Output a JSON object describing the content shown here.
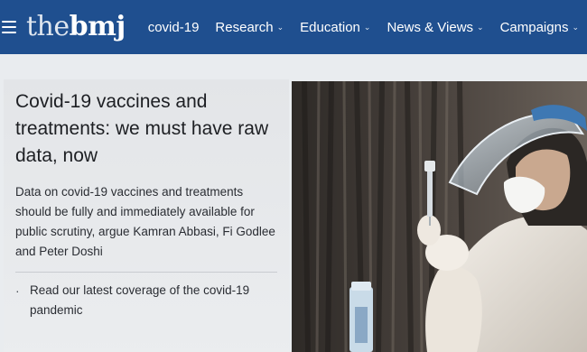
{
  "header": {
    "logo": {
      "the": "the",
      "bmj": "bmj"
    },
    "nav": [
      {
        "label": "covid-19",
        "has_menu": false
      },
      {
        "label": "Research",
        "has_menu": true
      },
      {
        "label": "Education",
        "has_menu": true
      },
      {
        "label": "News & Views",
        "has_menu": true
      },
      {
        "label": "Campaigns",
        "has_menu": true
      }
    ]
  },
  "article": {
    "headline": "Covid-19 vaccines and treatments: we must have raw data, now",
    "standfirst": "Data on covid-19 vaccines and treatments should be fully and immediately available for public scrutiny, argue Kamran Abbasi, Fi Godlee and Peter Doshi",
    "related_link": "Read our latest coverage of the covid-19 pandemic"
  },
  "colors": {
    "brand_blue": "#1f4f8f",
    "panel_grey": "#e9ecef"
  },
  "icons": {
    "menu": "hamburger-menu-icon",
    "chevron": "chevron-down-icon"
  }
}
